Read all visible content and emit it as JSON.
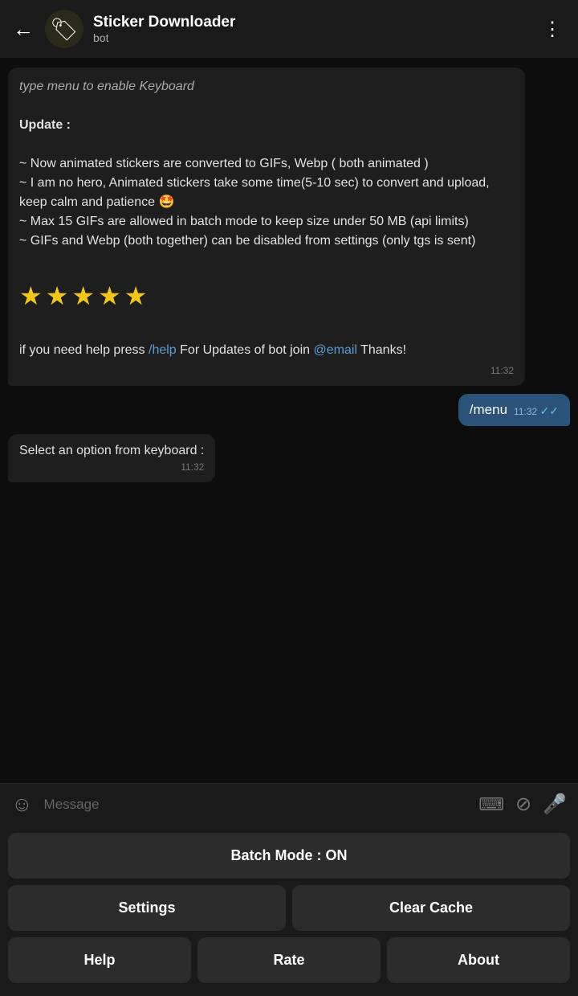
{
  "header": {
    "back_label": "←",
    "avatar_emoji": "🏷",
    "title": "Sticker Downloader",
    "subtitle": "bot",
    "more_icon": "⋮"
  },
  "chat": {
    "received_message": {
      "cut_top": "type menu to enable Keyboard",
      "update_label": "Update :",
      "lines": [
        "~ Now animated stickers are converted to GIFs, Webp ( both animated )",
        "~ I am no hero, Animated stickers take some time(5-10 sec) to convert and upload, keep calm and patience 🤩",
        "~ Max 15 GIFs are allowed in batch mode to keep size under 50 MB (api limits)",
        "~ GIFs and Webp (both together) can be disabled from settings (only tgs is sent)"
      ],
      "stars": "★★★★★",
      "help_text_before": "if you need help press ",
      "help_link": "/help",
      "help_text_middle": " For Updates of bot join ",
      "email_link": "@email",
      "help_text_after": " Thanks!",
      "timestamp": "11:32"
    },
    "sent_message": {
      "text": "/menu",
      "timestamp": "11:32",
      "ticks": "✓✓"
    },
    "system_message": {
      "text": "Select an option from keyboard :",
      "timestamp": "11:32"
    }
  },
  "input": {
    "placeholder": "Message",
    "emoji_icon": "☺",
    "keyboard_icon": "⌨",
    "attach_icon": "📎",
    "mic_icon": "🎤"
  },
  "keyboard": {
    "batch_mode_label": "Batch Mode : ON",
    "row2": {
      "settings_label": "Settings",
      "clear_cache_label": "Clear Cache"
    },
    "row3": {
      "help_label": "Help",
      "rate_label": "Rate",
      "about_label": "About"
    }
  }
}
